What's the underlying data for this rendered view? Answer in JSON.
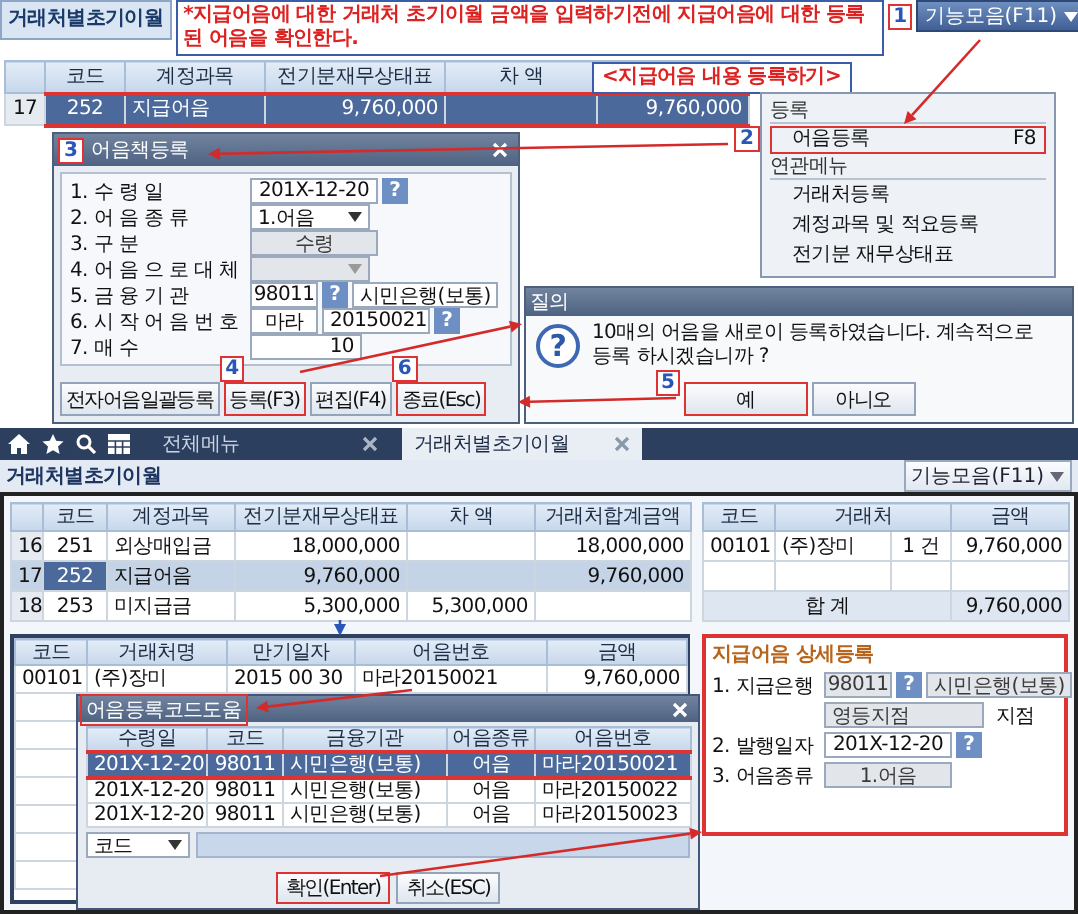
{
  "top_screen": {
    "tab": "거래처별초기이월",
    "note": "*지급어음에 대한 거래처 초기이월 금액을 입력하기전에 지급어음에 대한 등록된 어음을 확인한다.",
    "function_button": {
      "label": "기능모음(F11)",
      "callout": "1"
    },
    "subtitle": "<지급어음 내용 등록하기>",
    "table": {
      "columns": [
        "코드",
        "계정과목",
        "전기분재무상태표",
        "차 액"
      ],
      "rows": [
        {
          "number": "17",
          "cells": [
            "252",
            "지급어음",
            "9,760,000",
            null,
            "9,760,000"
          ],
          "selected": true
        }
      ]
    },
    "menu": [
      {
        "heading": "등록",
        "items": [
          {
            "label": "어음등록",
            "shortcut": "F8",
            "callout": "2",
            "selected": true
          }
        ]
      },
      {
        "heading": "연관메뉴",
        "items": [
          {
            "label": "거래처등록",
            "selected": false
          },
          {
            "label": "계정과목 및 적요등록",
            "selected": false
          },
          {
            "label": "전기분 재무상태표",
            "selected": false
          }
        ]
      }
    ]
  },
  "register_dialog": {
    "title": "어음책등록",
    "callout": "3",
    "fields": [
      {
        "label": "1. 수 령 일",
        "kind": "text",
        "value": "201X-12-20",
        "help": "?",
        "disabled": false
      },
      {
        "label": "2. 어 음 종 류",
        "kind": "select",
        "value": "1.어음",
        "disabled": false
      },
      {
        "label": "3. 구 분",
        "kind": "text",
        "value": "수령",
        "disabled": true
      },
      {
        "label": "4. 어 음 으 로 대 체",
        "kind": "select",
        "disabled": true
      },
      {
        "label": "5. 금 융 기 관",
        "kind": "lookup",
        "code": "98011",
        "help": "?",
        "name": "시민은행(보통)",
        "disabled": false
      },
      {
        "label": "6. 시 작 어 음 번 호",
        "kind": "number",
        "prefix": "마라",
        "value": "20150021",
        "help": "?",
        "disabled": false
      },
      {
        "label": "7. 매 수",
        "kind": "count",
        "value": "10",
        "disabled": false
      }
    ],
    "buttons": [
      {
        "label": "전자어음일괄등록"
      },
      {
        "label": "등록(F3)",
        "callout": "4"
      },
      {
        "label": "편집(F4)"
      },
      {
        "label": "종료(Esc)",
        "callout": "6"
      }
    ]
  },
  "confirm_dialog": {
    "title": "질의",
    "icon": "?",
    "message": "10매의 어음을 새로이 등록하였습니다. 계속적으로 등록 하시겠습니까 ?",
    "buttons": [
      {
        "label": "예",
        "callout": "5"
      },
      {
        "label": "아니오"
      }
    ]
  },
  "app": {
    "tabs": [
      {
        "label": "전체메뉴",
        "selected": false
      },
      {
        "label": "거래처별초기이월",
        "selected": true
      }
    ],
    "title": "거래처별초기이월",
    "function_button": "기능모음(F11)",
    "account_table": {
      "columns": [
        "코드",
        "계정과목",
        "전기분재무상태표",
        "차 액",
        "거래처합계금액"
      ],
      "rows": [
        {
          "number": "16",
          "cells": [
            "251",
            "외상매입금",
            "18,000,000",
            null,
            "18,000,000"
          ],
          "selected": false
        },
        {
          "number": "17",
          "cells": [
            "252",
            "지급어음",
            "9,760,000",
            null,
            "9,760,000"
          ],
          "selected": true
        },
        {
          "number": "18",
          "cells": [
            "253",
            "미지급금",
            "5,300,000",
            "5,300,000",
            null
          ],
          "selected": false
        }
      ]
    },
    "partner_table": {
      "columns": [
        "코드",
        "거래처",
        "금액"
      ],
      "rows": [
        {
          "code": "00101",
          "name": "(주)장미",
          "count": "1 건",
          "amount": "9,760,000"
        }
      ],
      "total_label": "합 계",
      "total": "9,760,000"
    },
    "note_table": {
      "columns": [
        "코드",
        "거래처명",
        "만기일자",
        "어음번호",
        "금액"
      ],
      "rows": [
        {
          "cells": [
            "00101",
            "(주)장미",
            "2015 00 30",
            "마라20150021",
            "9,760,000"
          ]
        }
      ]
    },
    "lookup_popup": {
      "title": "어음등록코드도움",
      "columns": [
        "수령일",
        "코드",
        "금융기관",
        "어음종류",
        "어음번호"
      ],
      "rows": [
        {
          "cells": [
            "201X-12-20",
            "98011",
            "시민은행(보통)",
            "어음",
            "마라20150021"
          ],
          "selected": true
        },
        {
          "cells": [
            "201X-12-20",
            "98011",
            "시민은행(보통)",
            "어음",
            "마라20150022"
          ],
          "selected": false
        },
        {
          "cells": [
            "201X-12-20",
            "98011",
            "시민은행(보통)",
            "어음",
            "마라20150023"
          ],
          "selected": false
        }
      ],
      "search_field": "코드",
      "buttons": [
        {
          "label": "확인(Enter)",
          "highlighted": true
        },
        {
          "label": "취소(ESC)",
          "highlighted": false
        }
      ]
    },
    "detail_panel": {
      "title": "지급어음 상세등록",
      "fields": [
        {
          "label": "1. 지급은행",
          "kind": "lookup",
          "code": "98011",
          "help": "?",
          "name": "시민은행(보통)",
          "disabled": true
        },
        {
          "kind": "suffix",
          "value": "영등지점",
          "suffix": "지점",
          "disabled": true
        },
        {
          "label": "2. 발행일자",
          "kind": "text",
          "value": "201X-12-20",
          "help": "?",
          "disabled": false
        },
        {
          "label": "3. 어음종류",
          "kind": "text",
          "value": "1.어음",
          "disabled": true
        }
      ]
    }
  }
}
